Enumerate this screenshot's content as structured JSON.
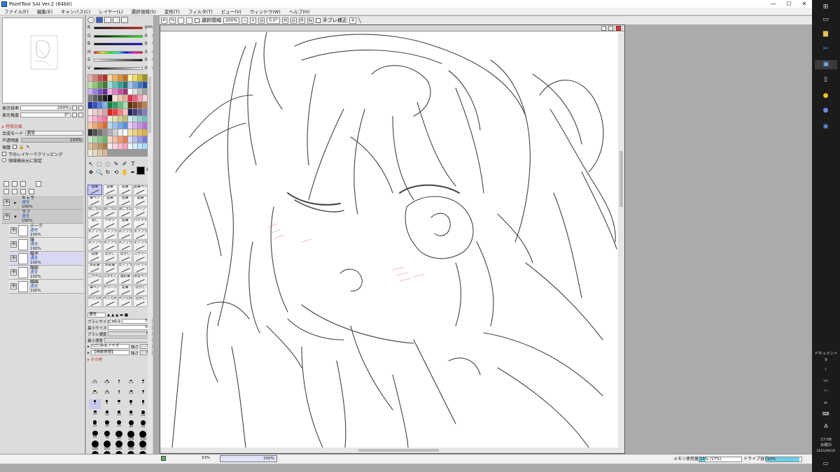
{
  "window": {
    "title": "PaintTool SAI Ver.2 (64bit)",
    "minimize": "—",
    "maximize": "☐",
    "close": "✕"
  },
  "menu": [
    "ファイル(F)",
    "編集(E)",
    "キャンバス(C)",
    "レイヤー(L)",
    "選択領域(S)",
    "変形(T)",
    "フィルタ(T)",
    "ビュー(V)",
    "ウィンドウ(W)",
    "ヘルプ(H)"
  ],
  "toolbar": {
    "selection_label": "選択領域",
    "zoom": "200%",
    "rotation": "0.0°",
    "stabilizer_label": "手ブレ補正",
    "stabilizer_value": "4"
  },
  "navigator": {
    "zoom_label": "表示倍率",
    "zoom_value": "200%",
    "angle_label": "表示角度",
    "angle_value": "0°"
  },
  "layer_panel": {
    "effects_title": "▸ 特殊効果",
    "blend_label": "合成モード",
    "blend_value": "通常",
    "opacity_label": "不透明度",
    "opacity_value": "100%",
    "protect_label": "保護",
    "clip_label": "下のレイヤーでクリッピング",
    "sample_label": "領域検出元に指定",
    "layers": [
      {
        "name": "キャラ",
        "mode": "通常",
        "opacity": "100%",
        "type": "folder",
        "collapsed": true
      },
      {
        "name": "ラフ",
        "mode": "通常",
        "opacity": "100%",
        "type": "folder",
        "collapsed": false
      },
      {
        "name": "テーク",
        "mode": "通常",
        "opacity": "100%",
        "type": "layer"
      },
      {
        "name": "服",
        "mode": "通常",
        "opacity": "100%",
        "type": "layer"
      },
      {
        "name": "帽子",
        "mode": "通常",
        "opacity": "100%",
        "type": "layer",
        "selected": true
      },
      {
        "name": "顔部",
        "mode": "通常",
        "opacity": "100%",
        "type": "layer"
      },
      {
        "name": "線画",
        "mode": "通常",
        "opacity": "100%",
        "type": "layer"
      }
    ]
  },
  "color_panel": {
    "sliders": [
      {
        "label": "R",
        "value": "000",
        "gradient": "linear-gradient(90deg,#000,#f00)"
      },
      {
        "label": "G",
        "value": "000",
        "gradient": "linear-gradient(90deg,#000,#0f0)"
      },
      {
        "label": "B",
        "value": "000",
        "gradient": "linear-gradient(90deg,#000,#00f)"
      },
      {
        "label": "H",
        "value": "340",
        "gradient": "linear-gradient(90deg,#f00,#ff0,#0f0,#0ff,#00f,#f0f,#f00)"
      },
      {
        "label": "S",
        "value": "000",
        "gradient": "linear-gradient(90deg,#fff,#000)"
      },
      {
        "label": "V",
        "value": "000",
        "gradient": "linear-gradient(90deg,#000,#fff)"
      }
    ],
    "primary_color": "#000000",
    "swatches": [
      "#e6b0b0",
      "#d58080",
      "#c85050",
      "#b03030",
      "#ffd8a0",
      "#f0b060",
      "#e09030",
      "#c07020",
      "#fff0a0",
      "#f0e060",
      "#d0c030",
      "#a09020",
      "#c0e0a0",
      "#90c870",
      "#60a050",
      "#407830",
      "#a0e0d8",
      "#60c0b8",
      "#30a098",
      "#207870",
      "#a0c8f0",
      "#70a0e0",
      "#4078c8",
      "#2050a0",
      "#c8b0f0",
      "#a080e0",
      "#8050c8",
      "#6030a0",
      "#f0b0e0",
      "#e080c8",
      "#c850a8",
      "#a03080",
      "#ffffff",
      "#e0e0e0",
      "#c0c0c0",
      "#a0a0a0",
      "#808080",
      "#606060",
      "#404040",
      "#202020",
      "#000000",
      "#f8e0d0",
      "#f0c8b0",
      "#e8b090",
      "#e03050",
      "#f06080",
      "#f8a0b8",
      "#fcd0dc",
      "#2030a0",
      "#3050c8",
      "#5080e0",
      "#80b0f0",
      "#108040",
      "#30a060",
      "#60c080",
      "#a0e0b0",
      "#603010",
      "#804020",
      "#a06030",
      "#c08050",
      "#fce8e8",
      "#f0d0d0",
      "#e8c0c0",
      "#d8a8a8",
      "#e02020",
      "#ff4040",
      "#ff8080",
      "#ffc0c0",
      "#202060",
      "#404080",
      "#6060a0",
      "#8080c0",
      "#ffd0e8",
      "#ffb0d0",
      "#ff90b8",
      "#ff70a0",
      "#f0f0d0",
      "#e0e0b0",
      "#d0d090",
      "#c0c070",
      "#d0f0f0",
      "#b0e0e0",
      "#90d0d0",
      "#70c0c0",
      "#f8c8a0",
      "#f0a878",
      "#e88850",
      "#e06828",
      "#b8d8f8",
      "#98c0f0",
      "#78a8e8",
      "#5890e0",
      "#e8d0f8",
      "#d8b0f0",
      "#c890e8",
      "#b870e0",
      "#303030",
      "#505050",
      "#707070",
      "#909090",
      "#b0b0b0",
      "#d0d0d0",
      "#f0f0f0",
      "#ffffff",
      "#f8e0a0",
      "#f0d080",
      "#e8c060",
      "#e0b040",
      "#c8e8c8",
      "#a8d8a8",
      "#88c888",
      "#68b868",
      "#fcd8c8",
      "#f8b8a0",
      "#f49878",
      "#f07850",
      "#d8d8f8",
      "#b8b8f0",
      "#9898e8",
      "#7878e0",
      "#e0c0a0",
      "#d0a880",
      "#c09060",
      "#b07840",
      "#ffe8f0",
      "#ffd0e0",
      "#ffb8d0",
      "#ffa0c0",
      "#e8f8ff",
      "#d0f0ff",
      "#b8e8ff",
      "#a0e0ff",
      "#f0e8d8",
      "#e8d8c0",
      "#e0c8a8",
      "#d8b890"
    ],
    "tools": [
      "↖",
      "⬚",
      "◌",
      "✎",
      "✐",
      "T",
      "✥",
      "🔍",
      "↻",
      "⟲",
      "✋",
      "✒"
    ],
    "brushes": [
      {
        "label": "鉛筆",
        "selected": true
      },
      {
        "label": "鉛筆"
      },
      {
        "label": "鉛筆"
      },
      {
        "label": "鉛筆ペン"
      },
      {
        "label": "筆ペン"
      },
      {
        "label": "鉛筆"
      },
      {
        "label": "鉛筆"
      },
      {
        "label": "鉛筆"
      },
      {
        "label": "消しゴム"
      },
      {
        "label": "消しゴム"
      },
      {
        "label": "消しゴム"
      },
      {
        "label": "テープ"
      },
      {
        "label": "消し"
      },
      {
        "label": "バケツ"
      },
      {
        "label": "鉛筆"
      },
      {
        "label": "ハイライト"
      },
      {
        "label": "エアブラシ"
      },
      {
        "label": "エアブラシ"
      },
      {
        "label": "エアブラシ"
      },
      {
        "label": "エアブラシ"
      },
      {
        "label": "エアブラシ"
      },
      {
        "label": "エアブラシ"
      },
      {
        "label": "エアブラシ"
      },
      {
        "label": "エアブラシ"
      },
      {
        "label": "鉛筆"
      },
      {
        "label": "ぼかし"
      },
      {
        "label": "ぼかし"
      },
      {
        "label": "スクリーン"
      },
      {
        "label": "水彩筆"
      },
      {
        "label": "水彩筆"
      },
      {
        "label": "エアブラシ"
      },
      {
        "label": "ハイライト"
      },
      {
        "label": "こげぺん"
      },
      {
        "label": "ふきだし"
      },
      {
        "label": "油彩筆"
      },
      {
        "label": "厚塗ペン"
      },
      {
        "label": "筆ペン"
      },
      {
        "label": "グリーン"
      },
      {
        "label": "鉛筆"
      },
      {
        "label": "ぼかし"
      },
      {
        "label": "ペン入れ"
      },
      {
        "label": "ペン入れ"
      },
      {
        "label": "ペン入れ"
      },
      {
        "label": "ぼかし"
      }
    ],
    "brush_props": {
      "mode": "通常",
      "size_label": "ブラシサイズ",
      "size_mult": "x0.1",
      "size_value": "5.0",
      "min_size_label": "最小サイズ",
      "min_size_value": "0%",
      "density_label": "ブラシ濃度",
      "density_value": "80",
      "min_density_label": "最小濃度",
      "texture_label": "にじみ＆ノイズ",
      "texture_strength_label": "強さ",
      "texture_strength": "70",
      "paper_label": "【用紙質感】",
      "paper_strength_label": "強さ",
      "paper_strength": "80",
      "other_label": "▸ その他"
    },
    "dot_sizes": [
      "0.5",
      "0.8",
      "1",
      "1.5",
      "2",
      "2.3",
      "2.6",
      "3",
      "3.5",
      "4",
      "5",
      "6",
      "7",
      "8",
      "9",
      "10",
      "12",
      "14",
      "16",
      "20",
      "25",
      "30",
      "35",
      "40",
      "50",
      "60",
      "70",
      "80",
      "100",
      "120",
      "160",
      "200",
      "250",
      "300",
      "350",
      "400",
      "500",
      "600",
      "700",
      "800"
    ],
    "dot_selected": "5"
  },
  "status": {
    "zoom_left": "33%",
    "zoom_right": "200%",
    "memory_label": "メモリ使用量",
    "memory_value": "15% (17%)",
    "memory_fraction": 0.15,
    "drive_label": "ドライブ容量",
    "drive_value": "93%",
    "drive_fraction": 0.93
  },
  "taskbar": {
    "document_label": "ドキュメント",
    "document_count": "9",
    "time": "17:08",
    "weekday": "水曜日",
    "date": "2021/06/16",
    "lang": "A",
    "icons": [
      "start-icon",
      "task-view-icon",
      "folder-icon",
      "snip-icon",
      "app-icon",
      "file-icon",
      "chrome-icon",
      "discord-icon",
      "app2-icon"
    ]
  }
}
